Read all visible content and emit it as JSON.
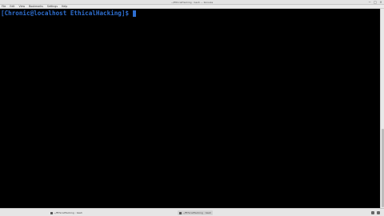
{
  "window": {
    "title": "~/EthicalHacking : bash — Konsole"
  },
  "menu": {
    "items": [
      "File",
      "Edit",
      "View",
      "Bookmarks",
      "Settings",
      "Help"
    ]
  },
  "terminal": {
    "prompt": "[Chronic@localhost EthicalHacking]$"
  },
  "taskbar": {
    "tasks": [
      {
        "label": "~/EthicalHacking : bash"
      },
      {
        "label": "~/EthicalHacking : bash"
      }
    ]
  },
  "colors": {
    "prompt": "#2e6fd1",
    "background": "#000000"
  }
}
